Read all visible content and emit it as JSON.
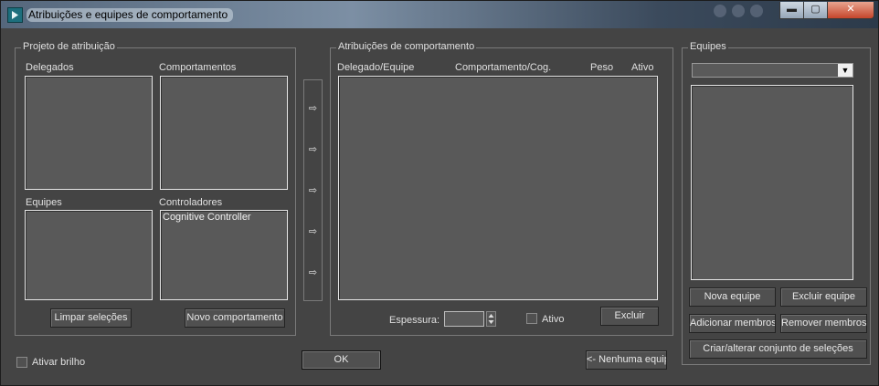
{
  "window": {
    "title": "Atribuições e equipes de comportamento",
    "min_glyph": "▬",
    "max_glyph": "▢",
    "close_glyph": "✕"
  },
  "assignment_design": {
    "group_label": "Projeto de atribuição",
    "delegates_label": "Delegados",
    "behaviors_label": "Comportamentos",
    "teams_label": "Equipes",
    "controllers_label": "Controladores",
    "controllers_items": [
      "Cognitive Controller"
    ],
    "clear_button": "Limpar seleções",
    "new_behavior_button": "Novo comportamento"
  },
  "arrows": [
    "⇨",
    "⇨",
    "⇨",
    "⇨",
    "⇨"
  ],
  "behavior_assignments": {
    "group_label": "Atribuições de comportamento",
    "col_delegate": "Delegado/Equipe",
    "col_behavior": "Comportamento/Cog.",
    "col_weight": "Peso",
    "col_active": "Ativo",
    "thickness_label": "Espessura:",
    "active_label": "Ativo",
    "delete_button": "Excluir"
  },
  "teams": {
    "group_label": "Equipes",
    "new_team": "Nova equipe",
    "delete_team": "Excluir equipe",
    "add_members": "Adicionar membros",
    "remove_members": "Remover membros",
    "create_selection_set": "Criar/alterar conjunto de seleções"
  },
  "footer": {
    "enable_glow": "Ativar brilho",
    "ok_button": "OK",
    "no_team_button": "<- Nenhuma equipe"
  }
}
